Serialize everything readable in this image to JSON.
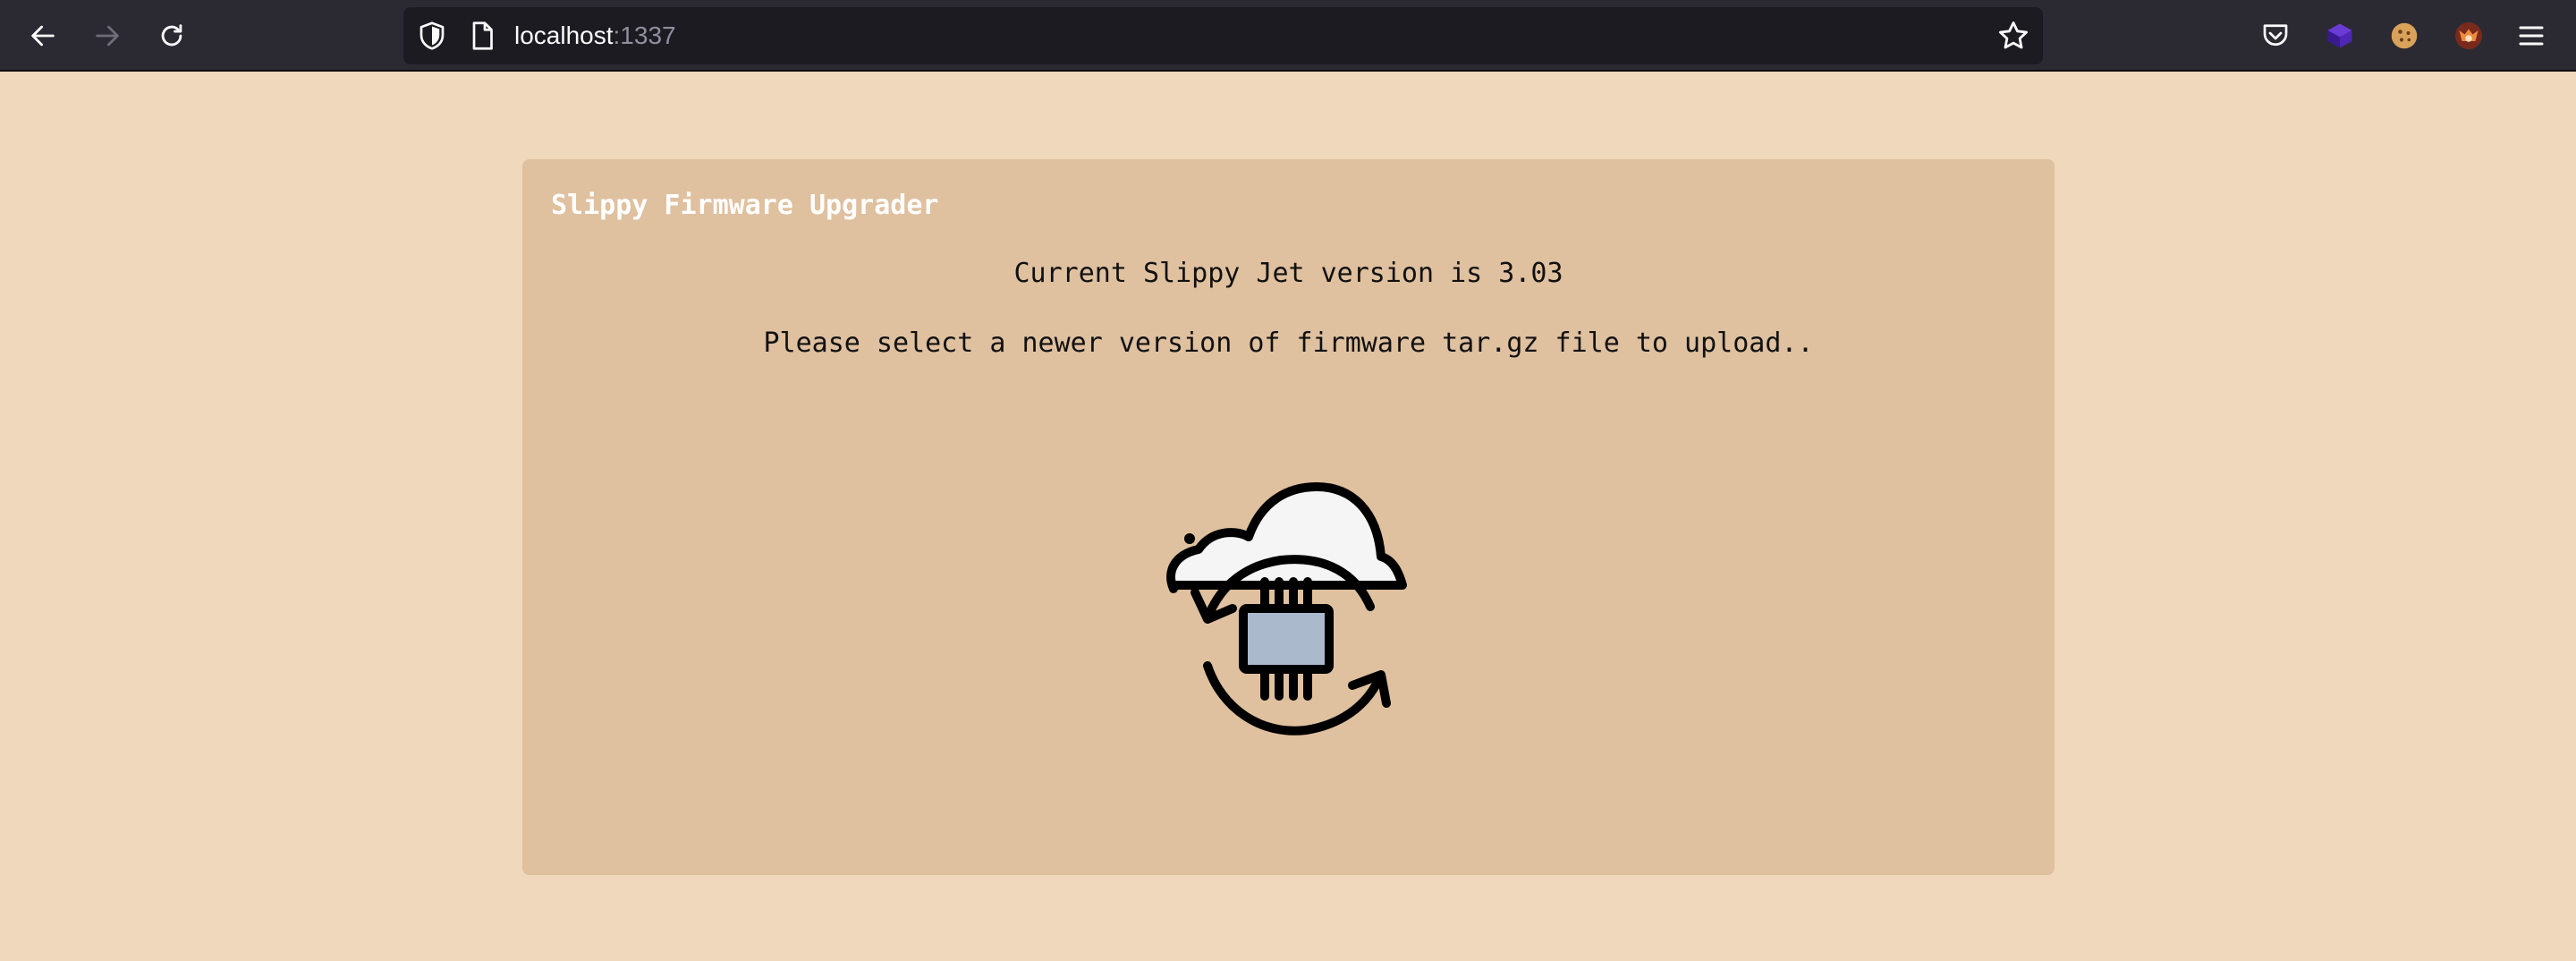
{
  "browser": {
    "url_host": "localhost",
    "url_port": ":1337",
    "icons": {
      "back": "back-arrow-icon",
      "forward": "forward-arrow-icon",
      "reload": "reload-icon",
      "shield": "tracking-protection-shield-icon",
      "page": "page-info-icon",
      "bookmark": "bookmark-star-icon",
      "pocket": "pocket-icon",
      "extension_1": "purple-cube-extension-icon",
      "extension_2": "cookie-extension-icon",
      "extension_3": "fox-avatar-extension-icon",
      "menu": "hamburger-menu-icon"
    }
  },
  "page": {
    "title": "Slippy Firmware Upgrader",
    "version_text": "Current Slippy Jet version is 3.03",
    "instruction_text": "Please select a newer version of firmware tar.gz file to upload..",
    "upload_icon": "cloud-firmware-update-icon"
  },
  "colors": {
    "page_background": "#efd8bb",
    "panel_background": "#dfc09f",
    "title_text": "#ffffff",
    "body_text": "#111111",
    "chip_fill": "#aab9cc",
    "cloud_fill": "#f5f5f5"
  }
}
